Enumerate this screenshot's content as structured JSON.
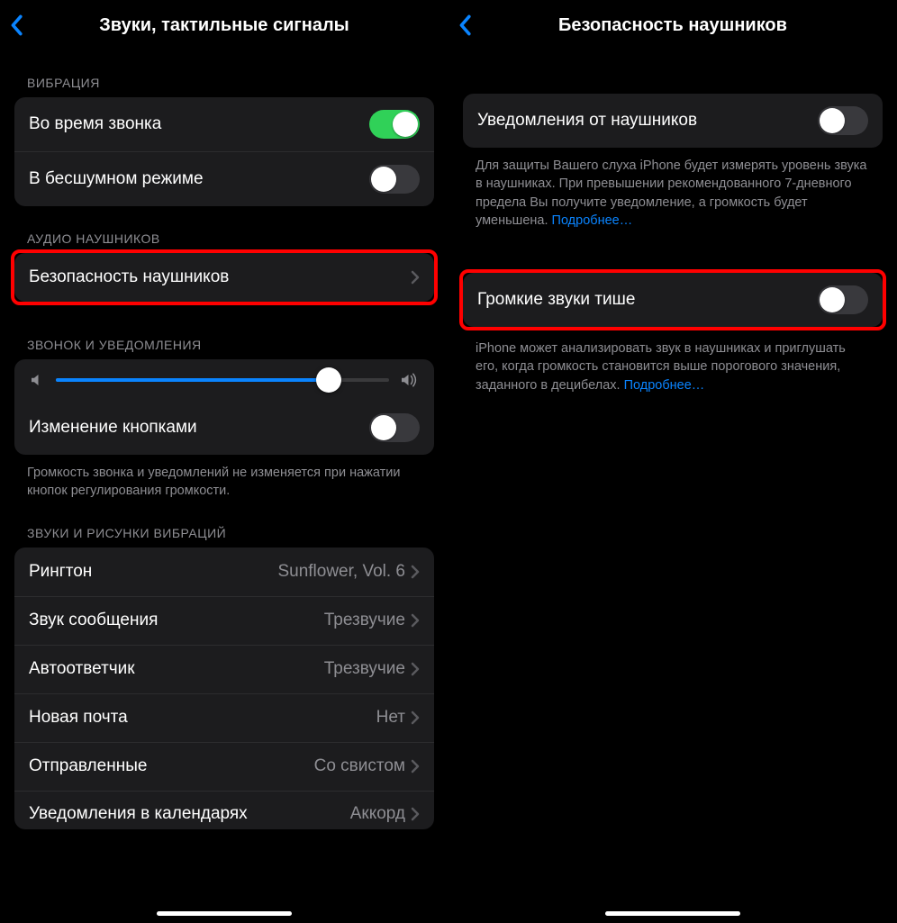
{
  "left": {
    "title": "Звуки, тактильные сигналы",
    "sections": {
      "vibration": {
        "header": "ВИБРАЦИЯ",
        "rows": {
          "onRing": {
            "label": "Во время звонка",
            "on": true
          },
          "onSilent": {
            "label": "В бесшумном режиме",
            "on": false
          }
        }
      },
      "headphoneAudio": {
        "header": "АУДИО НАУШНИКОВ",
        "safety": {
          "label": "Безопасность наушников"
        }
      },
      "ringer": {
        "header": "ЗВОНОК И УВЕДОМЛЕНИЯ",
        "volumePercent": 82,
        "changeWithButtons": {
          "label": "Изменение кнопками",
          "on": false
        },
        "footer": "Громкость звонка и уведомлений не изменяется при нажатии кнопок регулирования громкости."
      },
      "soundsPatterns": {
        "header": "ЗВУКИ И РИСУНКИ ВИБРАЦИЙ",
        "items": [
          {
            "label": "Рингтон",
            "value": "Sunflower, Vol. 6"
          },
          {
            "label": "Звук сообщения",
            "value": "Трезвучие"
          },
          {
            "label": "Автоответчик",
            "value": "Трезвучие"
          },
          {
            "label": "Новая почта",
            "value": "Нет"
          },
          {
            "label": "Отправленные",
            "value": "Со свистом"
          },
          {
            "label": "Уведомления в календарях",
            "value": "Аккорд"
          }
        ]
      }
    }
  },
  "right": {
    "title": "Безопасность наушников",
    "notifications": {
      "label": "Уведомления от наушников",
      "on": false,
      "footer": "Для защиты Вашего слуха iPhone будет измерять уровень звука в наушниках. При превышении рекомендованного 7-дневного предела Вы получите уведомление, а громкость будет уменьшена. ",
      "link": "Подробнее…"
    },
    "reduceLoud": {
      "label": "Громкие звуки тише",
      "on": false,
      "footer": "iPhone может анализировать звук в наушниках и приглушать его, когда громкость становится выше порогового значения, заданного в децибелах. ",
      "link": "Подробнее…"
    }
  }
}
